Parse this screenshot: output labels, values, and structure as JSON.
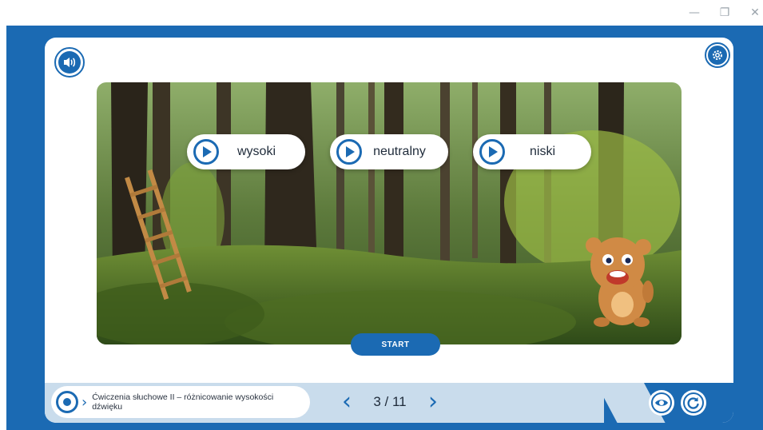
{
  "window": {
    "min_icon": "—",
    "max_icon": "❐",
    "close_icon": "✕"
  },
  "toolbar": {
    "sound_icon": "speaker-icon",
    "settings_icon": "gear-icon"
  },
  "options": [
    {
      "label": "wysoki"
    },
    {
      "label": "neutralny"
    },
    {
      "label": "niski"
    }
  ],
  "start_label": "START",
  "lesson": {
    "title": "Ćwiczenia słuchowe II – różnicowanie wysokości dźwięku"
  },
  "pager": {
    "current": "3",
    "total": "11",
    "text": "3 / 11",
    "prev": "‹",
    "next": "›"
  },
  "colors": {
    "primary": "#1b6ab3",
    "bar": "#c9dcec"
  }
}
